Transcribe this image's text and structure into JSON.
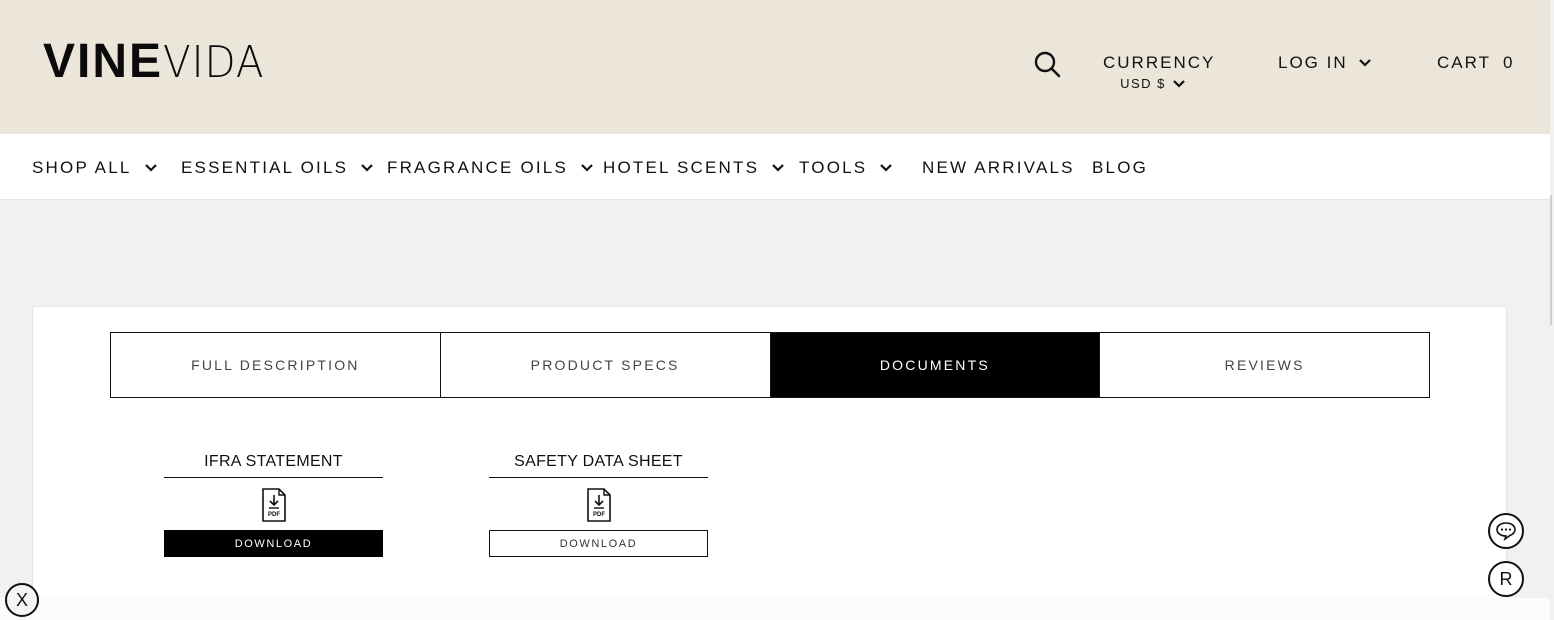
{
  "header": {
    "logo_bold": "VINE",
    "logo_thin": "VIDA",
    "search_icon": "search-icon",
    "currency_label": "CURRENCY",
    "currency_value": "USD $",
    "login_label": "LOG IN",
    "cart_label": "CART",
    "cart_count": "0"
  },
  "nav": {
    "items": [
      {
        "label": "SHOP ALL",
        "has_dropdown": true
      },
      {
        "label": "ESSENTIAL OILS",
        "has_dropdown": true
      },
      {
        "label": "FRAGRANCE OILS",
        "has_dropdown": true
      },
      {
        "label": "HOTEL SCENTS",
        "has_dropdown": true
      },
      {
        "label": "TOOLS",
        "has_dropdown": true
      },
      {
        "label": "NEW ARRIVALS",
        "has_dropdown": false
      },
      {
        "label": "BLOG",
        "has_dropdown": false
      }
    ]
  },
  "tabs": {
    "items": [
      "FULL DESCRIPTION",
      "PRODUCT SPECS",
      "DOCUMENTS",
      "REVIEWS"
    ],
    "active": "DOCUMENTS"
  },
  "documents": [
    {
      "title": "IFRA STATEMENT",
      "icon": "pdf-download-icon",
      "icon_text": "PDF",
      "button": "DOWNLOAD",
      "style": "filled"
    },
    {
      "title": "SAFETY DATA SHEET",
      "icon": "pdf-download-icon",
      "icon_text": "PDF",
      "button": "DOWNLOAD",
      "style": "outline"
    }
  ],
  "widgets": {
    "chat_icon": "chat-bubble-icon",
    "r_label": "R",
    "close_label": "X"
  },
  "colors": {
    "header_bg": "#ebe5da",
    "page_bg": "#f1f1f1",
    "active_tab_bg": "#000000",
    "text": "#111111"
  }
}
